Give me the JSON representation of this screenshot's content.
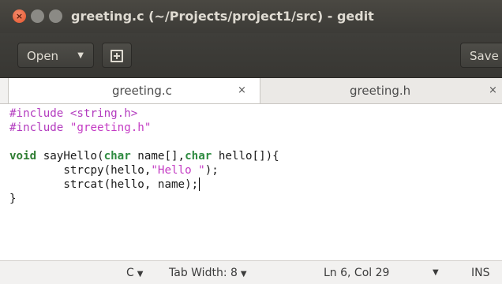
{
  "window": {
    "title": "greeting.c (~/Projects/project1/src) - gedit",
    "controls": {
      "close": "×",
      "minimize": "–",
      "maximize": "□"
    }
  },
  "toolbar": {
    "open_label": "Open",
    "open_arrow": "▼",
    "save_label": "Save"
  },
  "tabs": [
    {
      "label": "greeting.c",
      "close": "×",
      "active": true
    },
    {
      "label": "greeting.h",
      "close": "×",
      "active": false
    }
  ],
  "editor": {
    "lines": [
      [
        {
          "t": "#include <string.h>",
          "c": "pp"
        }
      ],
      [
        {
          "t": "#include ",
          "c": "pp"
        },
        {
          "t": "\"greeting.h\"",
          "c": "str"
        }
      ],
      [
        {
          "t": "",
          "c": ""
        }
      ],
      [
        {
          "t": "void",
          "c": "kw"
        },
        {
          "t": " sayHello(",
          "c": ""
        },
        {
          "t": "char",
          "c": "type"
        },
        {
          "t": " name[],",
          "c": ""
        },
        {
          "t": "char",
          "c": "type"
        },
        {
          "t": " hello[]){",
          "c": ""
        }
      ],
      [
        {
          "t": "        strcpy(hello,",
          "c": ""
        },
        {
          "t": "\"Hello \"",
          "c": "str"
        },
        {
          "t": ");",
          "c": ""
        }
      ],
      [
        {
          "t": "        strcat(hello, name);",
          "c": ""
        },
        {
          "t": "",
          "c": "cursor"
        }
      ],
      [
        {
          "t": "}",
          "c": ""
        }
      ]
    ]
  },
  "statusbar": {
    "language": "C",
    "language_arrow": "▼",
    "tab_width": "Tab Width: 8",
    "tab_width_arrow": "▼",
    "position": "Ln 6, Col 29",
    "position_arrow": "▼",
    "insert_mode": "INS"
  },
  "colors": {
    "titlebar": "#3c3b37",
    "close_button": "#e5552b",
    "preprocessor": "#b33bbf",
    "string": "#c43bc4",
    "keyword": "#2e7d32"
  },
  "icons": {
    "new_tab": "new-tab-icon",
    "dropdown": "chevron-down-icon"
  }
}
